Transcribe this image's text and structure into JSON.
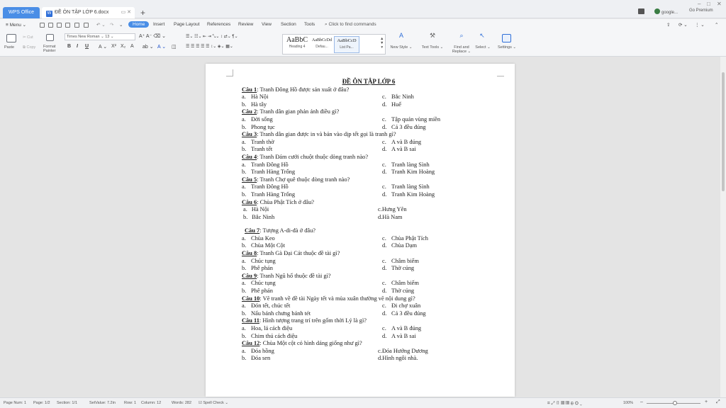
{
  "window": {
    "app_tab": "WPS Office",
    "doc_tab": "ĐỀ ÔN TẬP LỚP 6.docx",
    "new_tab_icon": "plus-icon",
    "account": "google...",
    "premium": "Go Premium"
  },
  "menu": {
    "main": "Menu",
    "tabs": [
      "Home",
      "Insert",
      "Page Layout",
      "References",
      "Review",
      "View",
      "Section",
      "Tools"
    ],
    "active_tab": "Home",
    "find_commands": "Click to find commands"
  },
  "ribbon": {
    "paste": "Paste",
    "cut": "Cut",
    "copy": "Copy",
    "format_painter_1": "Format",
    "format_painter_2": "Painter",
    "font_name": "Times New Roman",
    "font_size": "13",
    "styles": [
      {
        "sample": "AaBbC",
        "name": "Heading 4"
      },
      {
        "sample": "AaBbCcDd",
        "name": "Defau..."
      },
      {
        "sample": "AaBbCcD",
        "name": "List Pa..."
      }
    ],
    "new_style": "New Style",
    "text_tools": "Text Tools",
    "find_replace_1": "Find and",
    "find_replace_2": "Replace",
    "select": "Select",
    "settings": "Settings"
  },
  "document": {
    "title": "ĐỀ ÔN TẬP LỚP 6",
    "questions": [
      {
        "num": "Câu 1",
        "text": ": Tranh Đông Hồ được sản xuất ở đâu?",
        "a": "Hà Nội",
        "b": "Hà tây",
        "c": "Bắc Ninh",
        "d": "Huế"
      },
      {
        "num": "Câu 2",
        "text": ": Tranh dân gian phản ánh điều gì?",
        "a": "Đời sống",
        "b": "Phong tục",
        "c": "Tập quán vùng miền",
        "d": "Cả 3 đều đúng"
      },
      {
        "num": "Câu 3",
        "text": ": Tranh dân gian được in và bán vào dịp tết gọi là tranh gì?",
        "a": "Tranh thờ",
        "b": "Tranh tết",
        "c": "A và B đúng",
        "d": "A và B sai"
      },
      {
        "num": "Câu 4",
        "text": ": Tranh Đám cưới chuột thuộc dòng tranh nào?",
        "a": "Tranh Đông Hồ",
        "b": "Tranh Hàng Trống",
        "c": "Tranh làng Sình",
        "d": "Tranh Kim Hoàng"
      },
      {
        "num": "Câu 5",
        "text": ": Tranh Chợ quê thuộc dòng tranh nào?",
        "a": "Tranh Đông Hồ",
        "b": "Tranh Hàng Trống",
        "c": "Tranh làng Sình",
        "d": "Tranh Kim Hoàng"
      },
      {
        "num": "Câu 6",
        "text": ": Chùa Phật Tích ở đâu?",
        "a": "Hà Nội",
        "b": "Bắc Ninh",
        "c": "Hưng Yên",
        "d": "Hà Nam"
      },
      {
        "num": "Câu 7",
        "text": ": Tượng A-di-đà ở đâu?",
        "a": "Chùa Keo",
        "b": "Chùa Một Cột",
        "c": "Chùa Phật Tích",
        "d": "Chùa Dạm"
      },
      {
        "num": "Câu 8",
        "text": ": Tranh Gà Đại Cát thuộc đề tài gì?",
        "a": "Chúc tụng",
        "b": "Phê phán",
        "c": "Châm biếm",
        "d": "Thờ cúng"
      },
      {
        "num": "Câu 9",
        "text": ": Tranh Ngũ hổ thuộc đề tài gì?",
        "a": "Chúc tụng",
        "b": "Phê phán",
        "c": "Châm biếm",
        "d": "Thờ cúng"
      },
      {
        "num": "Câu 10",
        "text": ": Vẽ tranh về đề tài Ngày tết và mùa xuân thường vẽ nội dung gì?",
        "a": "Đón tết, chúc tết",
        "b": "Nấu bánh chưng bánh tét",
        "c": "Đi chợ xuân",
        "d": "Cả 3 đều đúng"
      },
      {
        "num": "Câu 11",
        "text": ": Hình tượng trang trí trên gốm thời Lý là gì?",
        "a": "Hoa, lá cách điệu",
        "b": "Chim thú cách điệu",
        "c": "A và B đúng",
        "d": "A và B sai"
      },
      {
        "num": "Câu 12",
        "text": ": Chùa Một cột có hình dáng giống như gì?",
        "a": "Đóa hồng",
        "b": "Đóa sen",
        "c": "Đóa Hướng Dương",
        "d": "Hình ngôi nhà."
      }
    ]
  },
  "status": {
    "page_num": "Page Num: 1",
    "page": "Page: 1/2",
    "section": "Section: 1/1",
    "set_value": "SetValue: 7.2in",
    "row": "Row: 1",
    "column": "Column: 12",
    "words": "Words: 282",
    "spell_check": "Spell Check",
    "zoom": "100%"
  }
}
